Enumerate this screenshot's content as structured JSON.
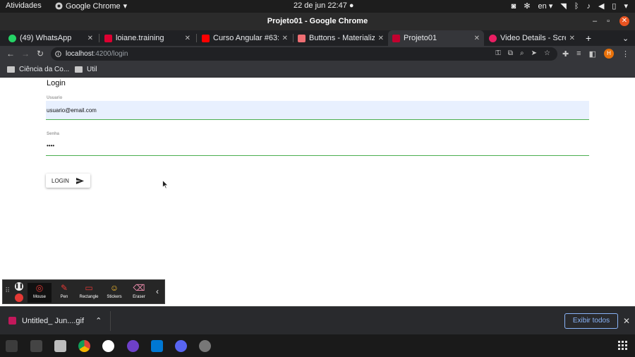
{
  "topbar": {
    "activities": "Atividades",
    "app_name": "Google Chrome",
    "datetime": "22 de jun  22:47",
    "lang": "en"
  },
  "window": {
    "title": "Projeto01 - Google Chrome"
  },
  "tabs": [
    {
      "label": "(49) WhatsApp",
      "icon": "whatsapp-icon",
      "color": "#25d366"
    },
    {
      "label": "loiane.training",
      "icon": "angular-icon",
      "color": "#dd0031"
    },
    {
      "label": "Curso Angular #63: F",
      "icon": "youtube-icon",
      "color": "#ff0000"
    },
    {
      "label": "Buttons - Materialize",
      "icon": "materialize-icon",
      "color": "#ee6e73"
    },
    {
      "label": "Projeto01",
      "icon": "angular-icon",
      "color": "#c3002f"
    },
    {
      "label": "Video Details - Scree",
      "icon": "video-icon",
      "color": "#e91e63"
    }
  ],
  "address": {
    "host": "localhost",
    "path": ":4200/login"
  },
  "bookmarks": [
    {
      "label": "Ciência da Co..."
    },
    {
      "label": "Util"
    }
  ],
  "page": {
    "title": "Login",
    "email_label": "Usuario",
    "email_value": "usuario@email.com",
    "password_label": "Senha",
    "password_value": "••••",
    "login_button": "LOGIN"
  },
  "annotation_toolbar": {
    "tools": [
      "Mouse",
      "Pen",
      "Rectangle",
      "Stickers",
      "Eraser"
    ]
  },
  "download": {
    "filename": "Untitled_ Jun....gif",
    "show_all": "Exibir todos"
  },
  "colors": {
    "accent_green": "#4caf50",
    "autofill_bg": "#e8f0fe",
    "ubuntu_orange": "#e95420"
  }
}
